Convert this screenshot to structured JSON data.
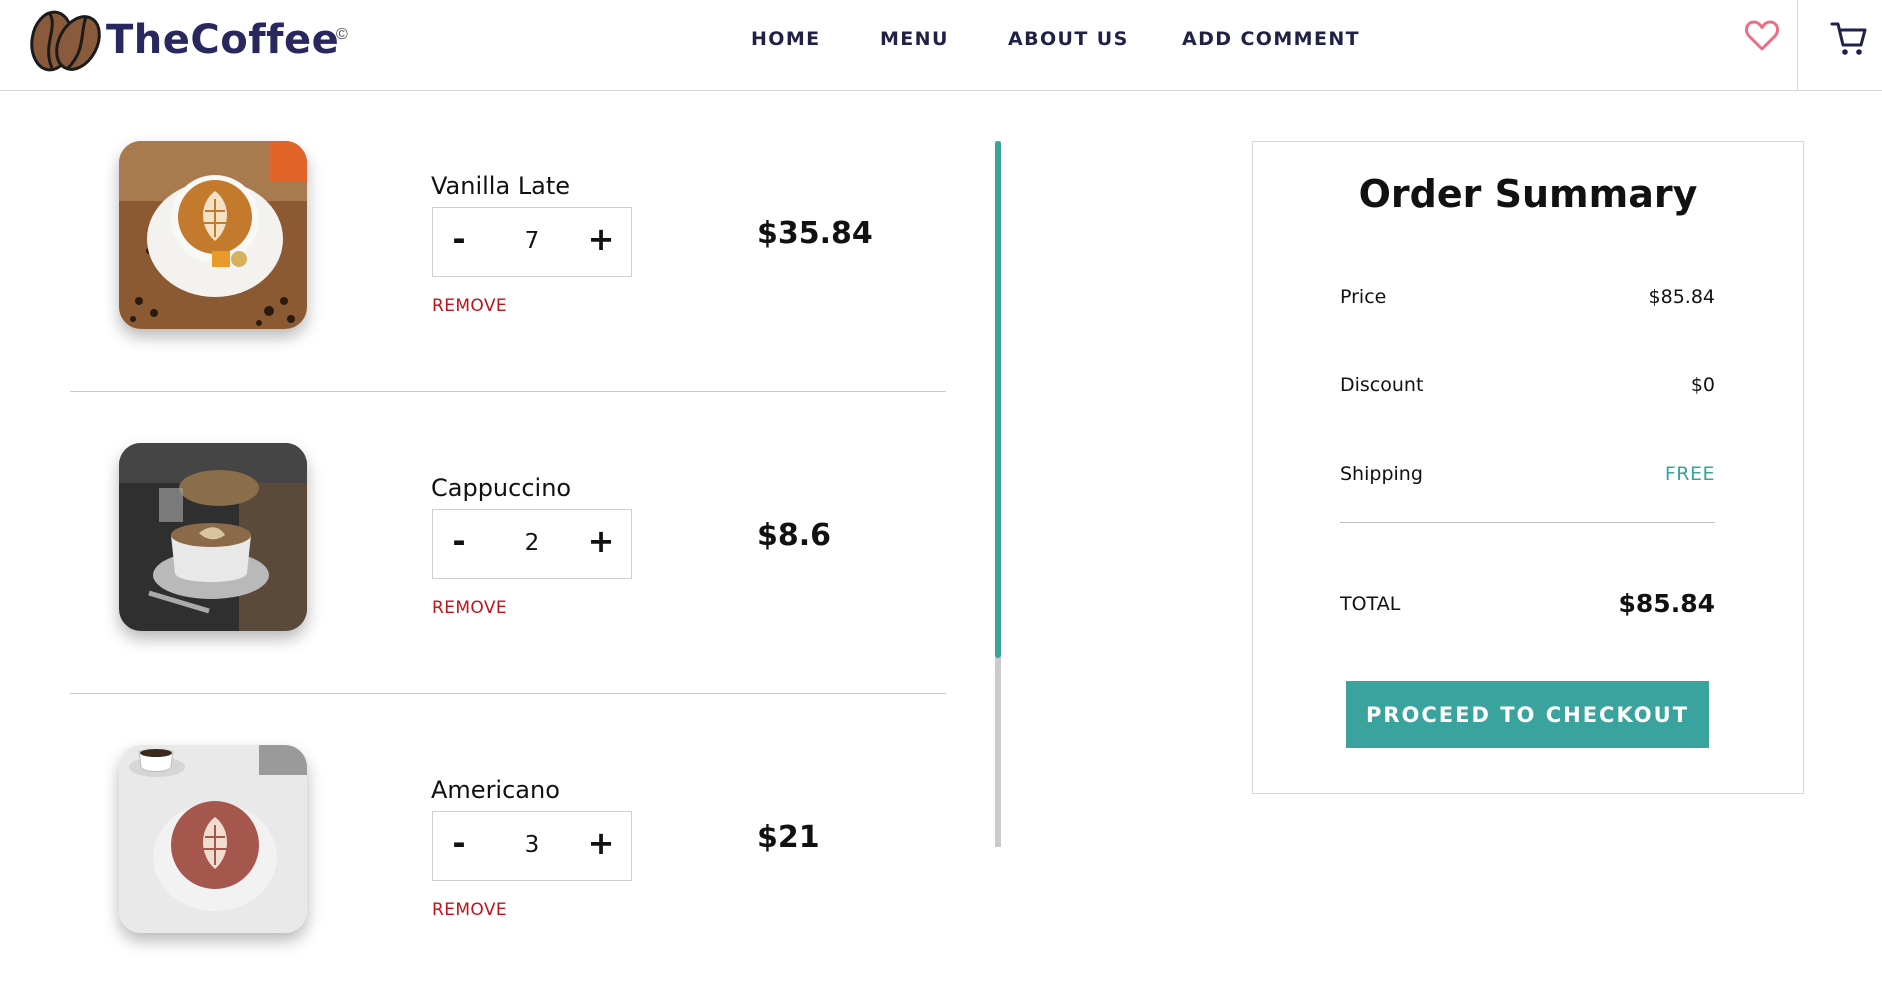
{
  "brand": {
    "name": "TheCoffee",
    "symbol": "©"
  },
  "nav": [
    {
      "label": "HOME"
    },
    {
      "label": "MENU"
    },
    {
      "label": "ABOUT US"
    },
    {
      "label": "ADD COMMENT"
    }
  ],
  "icons": {
    "favorites": "heart-icon",
    "cart": "cart-icon"
  },
  "colors": {
    "accent": "#3aa39e",
    "brand": "#28285e",
    "remove": "#c0121b"
  },
  "cart": {
    "remove_label": "REMOVE",
    "items": [
      {
        "name": "Vanilla Late",
        "quantity": "7",
        "price": "$35.84",
        "minus": "-",
        "plus": "+"
      },
      {
        "name": "Cappuccino",
        "quantity": "2",
        "price": "$8.6",
        "minus": "-",
        "plus": "+"
      },
      {
        "name": "Americano",
        "quantity": "3",
        "price": "$21",
        "minus": "-",
        "plus": "+"
      }
    ]
  },
  "summary": {
    "title": "Order Summary",
    "price_label": "Price",
    "price_value": "$85.84",
    "discount_label": "Discount",
    "discount_value": "$0",
    "shipping_label": "Shipping",
    "shipping_value": "FREE",
    "total_label": "TOTAL",
    "total_value": "$85.84",
    "checkout_label": "PROCEED TO CHECKOUT"
  }
}
